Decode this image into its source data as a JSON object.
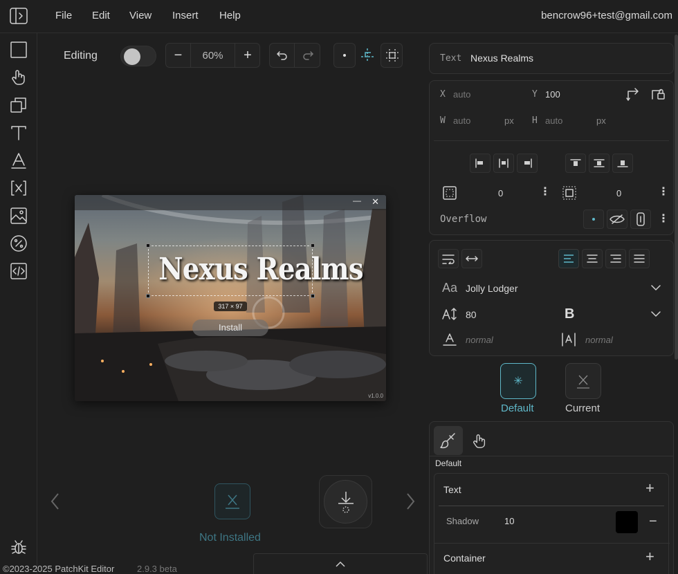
{
  "menu": {
    "file": "File",
    "edit": "Edit",
    "view": "View",
    "insert": "Insert",
    "help": "Help"
  },
  "user": {
    "email": "bencrow96+test@gmail.com"
  },
  "toolbar": {
    "mode_label": "Editing",
    "zoom": "60%",
    "zoom_out": "−",
    "zoom_in": "+"
  },
  "preview": {
    "title_text": "Nexus Realms",
    "selection_size": "317 × 97",
    "install_label": "Install",
    "version": "v1.0.0",
    "minimize": "—",
    "close": "✕"
  },
  "stage": {
    "status_label": "Not Installed"
  },
  "footer": {
    "copyright": "©2023-2025 PatchKit Editor",
    "version": "2.9.3 beta"
  },
  "inspector": {
    "type_label": "Text",
    "element_name": "Nexus Realms",
    "x_label": "X",
    "x_value": "auto",
    "y_label": "Y",
    "y_value": "100",
    "w_label": "W",
    "w_value": "auto",
    "w_unit": "px",
    "h_label": "H",
    "h_value": "auto",
    "h_unit": "px",
    "padding_value": "0",
    "margin_value": "0",
    "overflow_label": "Overflow",
    "font_family": "Jolly Lodger",
    "font_size": "80",
    "bold_label": "B",
    "letter_spacing": "normal",
    "line_height": "normal",
    "state_default": "Default",
    "state_current": "Current",
    "style_tab_label": "Default",
    "text_section": "Text",
    "shadow_label": "Shadow",
    "shadow_value": "10",
    "shadow_color": "#000000",
    "container_section": "Container"
  },
  "colors": {
    "accent": "#5fb8c9",
    "background": "#1f1f1f",
    "panel": "#222222"
  }
}
